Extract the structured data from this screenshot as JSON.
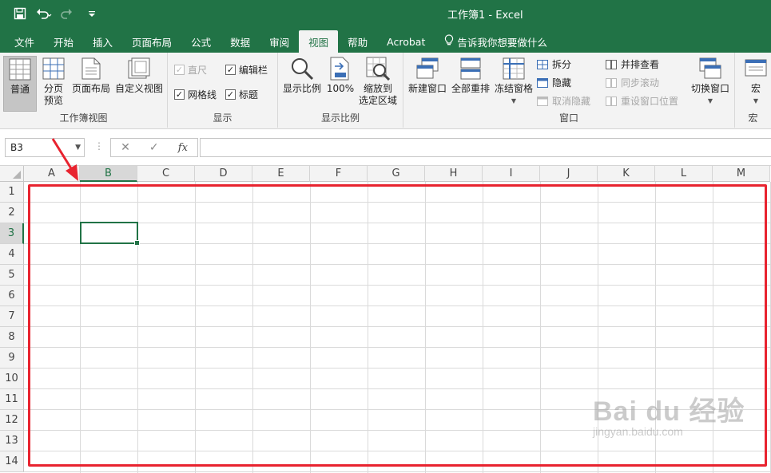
{
  "window": {
    "title": "工作簿1  -  Excel"
  },
  "colors": {
    "brand": "#217346",
    "highlight": "#e8232f"
  },
  "qat": {
    "icons": [
      "save-icon",
      "undo-icon",
      "redo-icon",
      "customize-icon"
    ]
  },
  "tabs": [
    {
      "label": "文件"
    },
    {
      "label": "开始"
    },
    {
      "label": "插入"
    },
    {
      "label": "页面布局"
    },
    {
      "label": "公式"
    },
    {
      "label": "数据"
    },
    {
      "label": "审阅"
    },
    {
      "label": "视图",
      "active": true
    },
    {
      "label": "帮助"
    },
    {
      "label": "Acrobat"
    },
    {
      "label": "告诉我你想要做什么"
    }
  ],
  "ribbon": {
    "workbook_views": {
      "label": "工作簿视图",
      "normal": "普通",
      "page_break_line1": "分页",
      "page_break_line2": "预览",
      "page_layout": "页面布局",
      "custom_views": "自定义视图"
    },
    "show": {
      "label": "显示",
      "ruler": "直尺",
      "formula_bar": "编辑栏",
      "gridlines": "网格线",
      "headings": "标题"
    },
    "zoom": {
      "label": "显示比例",
      "zoom": "显示比例",
      "hundred": "100%",
      "zoom_sel_line1": "缩放到",
      "zoom_sel_line2": "选定区域"
    },
    "window": {
      "label": "窗口",
      "new_window": "新建窗口",
      "arrange_all": "全部重排",
      "freeze_panes": "冻结窗格",
      "split": "拆分",
      "hide": "隐藏",
      "unhide": "取消隐藏",
      "side_by_side": "并排查看",
      "sync_scroll": "同步滚动",
      "reset_position": "重设窗口位置",
      "switch_windows": "切换窗口"
    },
    "macros": {
      "label": "宏",
      "macros": "宏"
    }
  },
  "formula_bar": {
    "name_box": "B3",
    "formula": "",
    "fx": "fx"
  },
  "grid": {
    "columns": [
      "A",
      "B",
      "C",
      "D",
      "E",
      "F",
      "G",
      "H",
      "I",
      "J",
      "K",
      "L",
      "M"
    ],
    "rows": [
      "1",
      "2",
      "3",
      "4",
      "5",
      "6",
      "7",
      "8",
      "9",
      "10",
      "11",
      "12",
      "13",
      "14"
    ],
    "active_column": "B",
    "active_row": "3"
  },
  "watermark": {
    "logo": "Bai du 经验",
    "sub": "jingyan.baidu.com"
  }
}
